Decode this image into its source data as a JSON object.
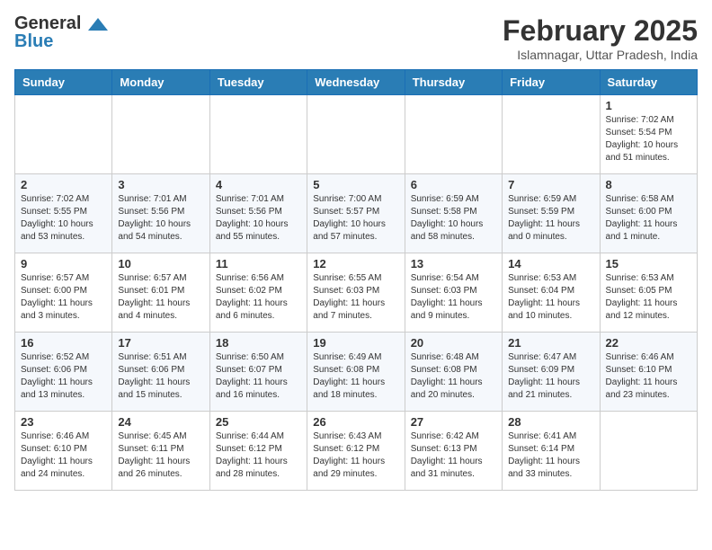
{
  "header": {
    "logo": {
      "general": "General",
      "blue": "Blue"
    },
    "month": "February 2025",
    "location": "Islamnagar, Uttar Pradesh, India"
  },
  "weekdays": [
    "Sunday",
    "Monday",
    "Tuesday",
    "Wednesday",
    "Thursday",
    "Friday",
    "Saturday"
  ],
  "weeks": [
    [
      {
        "day": "",
        "info": ""
      },
      {
        "day": "",
        "info": ""
      },
      {
        "day": "",
        "info": ""
      },
      {
        "day": "",
        "info": ""
      },
      {
        "day": "",
        "info": ""
      },
      {
        "day": "",
        "info": ""
      },
      {
        "day": "1",
        "info": "Sunrise: 7:02 AM\nSunset: 5:54 PM\nDaylight: 10 hours\nand 51 minutes."
      }
    ],
    [
      {
        "day": "2",
        "info": "Sunrise: 7:02 AM\nSunset: 5:55 PM\nDaylight: 10 hours\nand 53 minutes."
      },
      {
        "day": "3",
        "info": "Sunrise: 7:01 AM\nSunset: 5:56 PM\nDaylight: 10 hours\nand 54 minutes."
      },
      {
        "day": "4",
        "info": "Sunrise: 7:01 AM\nSunset: 5:56 PM\nDaylight: 10 hours\nand 55 minutes."
      },
      {
        "day": "5",
        "info": "Sunrise: 7:00 AM\nSunset: 5:57 PM\nDaylight: 10 hours\nand 57 minutes."
      },
      {
        "day": "6",
        "info": "Sunrise: 6:59 AM\nSunset: 5:58 PM\nDaylight: 10 hours\nand 58 minutes."
      },
      {
        "day": "7",
        "info": "Sunrise: 6:59 AM\nSunset: 5:59 PM\nDaylight: 11 hours\nand 0 minutes."
      },
      {
        "day": "8",
        "info": "Sunrise: 6:58 AM\nSunset: 6:00 PM\nDaylight: 11 hours\nand 1 minute."
      }
    ],
    [
      {
        "day": "9",
        "info": "Sunrise: 6:57 AM\nSunset: 6:00 PM\nDaylight: 11 hours\nand 3 minutes."
      },
      {
        "day": "10",
        "info": "Sunrise: 6:57 AM\nSunset: 6:01 PM\nDaylight: 11 hours\nand 4 minutes."
      },
      {
        "day": "11",
        "info": "Sunrise: 6:56 AM\nSunset: 6:02 PM\nDaylight: 11 hours\nand 6 minutes."
      },
      {
        "day": "12",
        "info": "Sunrise: 6:55 AM\nSunset: 6:03 PM\nDaylight: 11 hours\nand 7 minutes."
      },
      {
        "day": "13",
        "info": "Sunrise: 6:54 AM\nSunset: 6:03 PM\nDaylight: 11 hours\nand 9 minutes."
      },
      {
        "day": "14",
        "info": "Sunrise: 6:53 AM\nSunset: 6:04 PM\nDaylight: 11 hours\nand 10 minutes."
      },
      {
        "day": "15",
        "info": "Sunrise: 6:53 AM\nSunset: 6:05 PM\nDaylight: 11 hours\nand 12 minutes."
      }
    ],
    [
      {
        "day": "16",
        "info": "Sunrise: 6:52 AM\nSunset: 6:06 PM\nDaylight: 11 hours\nand 13 minutes."
      },
      {
        "day": "17",
        "info": "Sunrise: 6:51 AM\nSunset: 6:06 PM\nDaylight: 11 hours\nand 15 minutes."
      },
      {
        "day": "18",
        "info": "Sunrise: 6:50 AM\nSunset: 6:07 PM\nDaylight: 11 hours\nand 16 minutes."
      },
      {
        "day": "19",
        "info": "Sunrise: 6:49 AM\nSunset: 6:08 PM\nDaylight: 11 hours\nand 18 minutes."
      },
      {
        "day": "20",
        "info": "Sunrise: 6:48 AM\nSunset: 6:08 PM\nDaylight: 11 hours\nand 20 minutes."
      },
      {
        "day": "21",
        "info": "Sunrise: 6:47 AM\nSunset: 6:09 PM\nDaylight: 11 hours\nand 21 minutes."
      },
      {
        "day": "22",
        "info": "Sunrise: 6:46 AM\nSunset: 6:10 PM\nDaylight: 11 hours\nand 23 minutes."
      }
    ],
    [
      {
        "day": "23",
        "info": "Sunrise: 6:46 AM\nSunset: 6:10 PM\nDaylight: 11 hours\nand 24 minutes."
      },
      {
        "day": "24",
        "info": "Sunrise: 6:45 AM\nSunset: 6:11 PM\nDaylight: 11 hours\nand 26 minutes."
      },
      {
        "day": "25",
        "info": "Sunrise: 6:44 AM\nSunset: 6:12 PM\nDaylight: 11 hours\nand 28 minutes."
      },
      {
        "day": "26",
        "info": "Sunrise: 6:43 AM\nSunset: 6:12 PM\nDaylight: 11 hours\nand 29 minutes."
      },
      {
        "day": "27",
        "info": "Sunrise: 6:42 AM\nSunset: 6:13 PM\nDaylight: 11 hours\nand 31 minutes."
      },
      {
        "day": "28",
        "info": "Sunrise: 6:41 AM\nSunset: 6:14 PM\nDaylight: 11 hours\nand 33 minutes."
      },
      {
        "day": "",
        "info": ""
      }
    ]
  ]
}
